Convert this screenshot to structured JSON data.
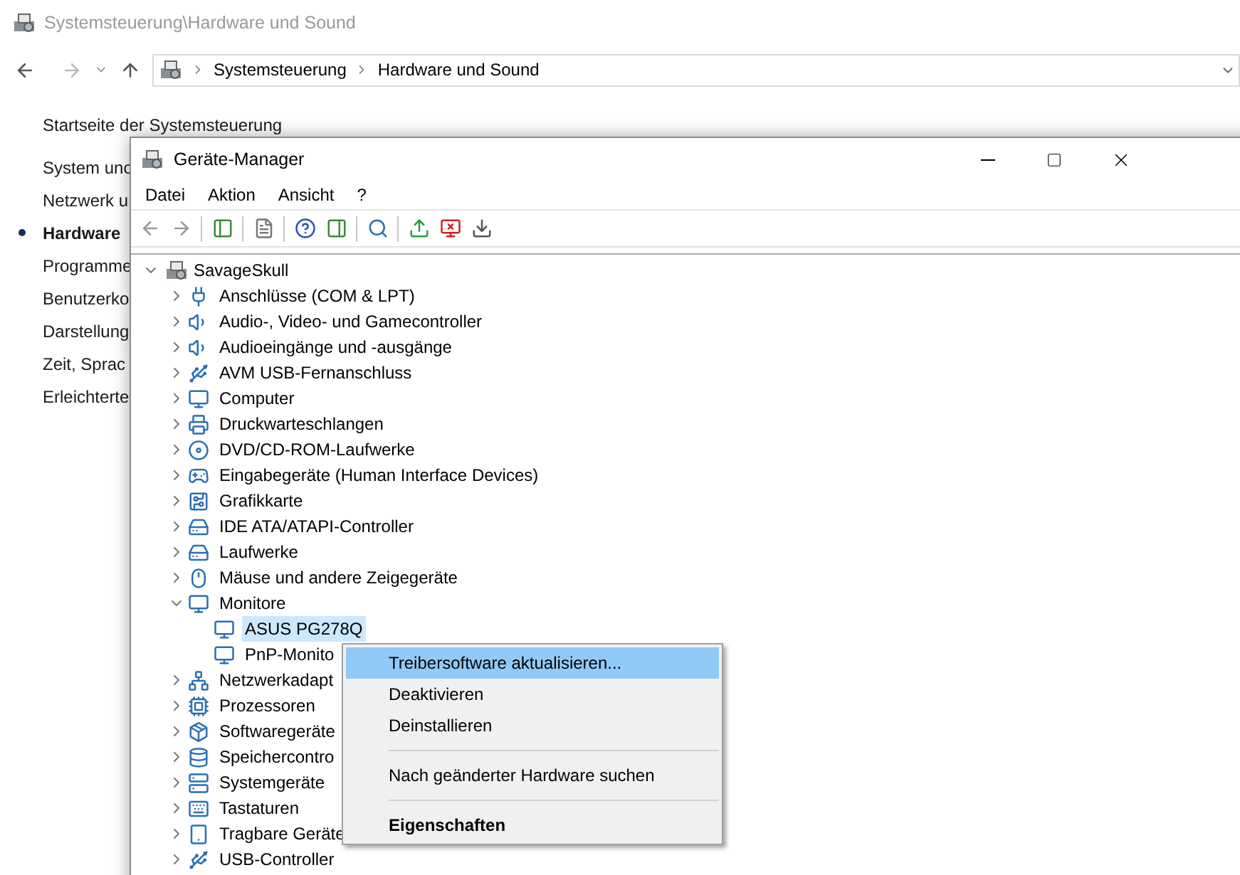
{
  "explorer": {
    "title": "Systemsteuerung\\Hardware und Sound",
    "breadcrumb": [
      "Systemsteuerung",
      "Hardware und Sound"
    ],
    "home_link": "Startseite der Systemsteuerung",
    "nav": [
      {
        "label": "System unc",
        "selected": false
      },
      {
        "label": "Netzwerk u",
        "selected": false
      },
      {
        "label": "Hardware",
        "selected": true
      },
      {
        "label": "Programme",
        "selected": false
      },
      {
        "label": "Benutzerko",
        "selected": false
      },
      {
        "label": "Darstellung",
        "selected": false
      },
      {
        "label": "Zeit, Sprac",
        "selected": false
      },
      {
        "label": "Erleichterte",
        "selected": false
      }
    ]
  },
  "device_manager": {
    "title": "Geräte-Manager",
    "menu": [
      "Datei",
      "Aktion",
      "Ansicht",
      "?"
    ],
    "tree": {
      "label": "SavageSkull",
      "expanded": true,
      "children": [
        {
          "label": "Anschlüsse (COM & LPT)",
          "expanded": false
        },
        {
          "label": "Audio-, Video- und Gamecontroller",
          "expanded": false
        },
        {
          "label": "Audioeingänge und -ausgänge",
          "expanded": false
        },
        {
          "label": "AVM USB-Fernanschluss",
          "expanded": false
        },
        {
          "label": "Computer",
          "expanded": false
        },
        {
          "label": "Druckwarteschlangen",
          "expanded": false
        },
        {
          "label": "DVD/CD-ROM-Laufwerke",
          "expanded": false
        },
        {
          "label": "Eingabegeräte (Human Interface Devices)",
          "expanded": false
        },
        {
          "label": "Grafikkarte",
          "expanded": false
        },
        {
          "label": "IDE ATA/ATAPI-Controller",
          "expanded": false
        },
        {
          "label": "Laufwerke",
          "expanded": false
        },
        {
          "label": "Mäuse und andere Zeigegeräte",
          "expanded": false
        },
        {
          "label": "Monitore",
          "expanded": true,
          "children": [
            {
              "label": "ASUS PG278Q",
              "selected": true
            },
            {
              "label": "PnP-Monito",
              "selected": false
            }
          ]
        },
        {
          "label": "Netzwerkadapt",
          "expanded": false
        },
        {
          "label": "Prozessoren",
          "expanded": false
        },
        {
          "label": "Softwaregeräte",
          "expanded": false
        },
        {
          "label": "Speichercontro",
          "expanded": false
        },
        {
          "label": "Systemgeräte",
          "expanded": false
        },
        {
          "label": "Tastaturen",
          "expanded": false
        },
        {
          "label": "Tragbare Geräte",
          "expanded": false
        },
        {
          "label": "USB-Controller",
          "expanded": false
        }
      ]
    }
  },
  "context_menu": [
    {
      "kind": "item",
      "label": "Treibersoftware aktualisieren...",
      "selected": true,
      "default": false
    },
    {
      "kind": "item",
      "label": "Deaktivieren",
      "selected": false,
      "default": false
    },
    {
      "kind": "item",
      "label": "Deinstallieren",
      "selected": false,
      "default": false
    },
    {
      "kind": "separator"
    },
    {
      "kind": "item",
      "label": "Nach geänderter Hardware suchen",
      "selected": false,
      "default": false
    },
    {
      "kind": "separator"
    },
    {
      "kind": "item",
      "label": "Eigenschaften",
      "selected": false,
      "default": true
    }
  ]
}
